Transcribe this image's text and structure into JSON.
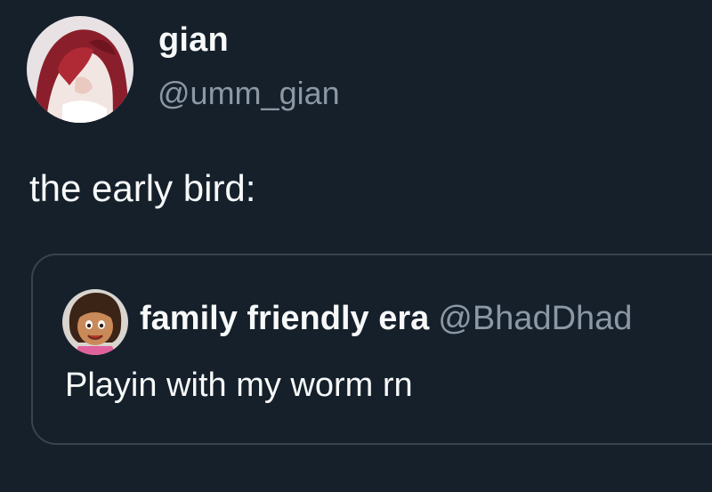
{
  "tweet": {
    "author": {
      "display_name": "gian",
      "handle": "@umm_gian",
      "avatar_icon": "anime-portrait-avatar-icon"
    },
    "text": "the early bird:",
    "quote": {
      "author": {
        "display_name": "family friendly era",
        "handle": "@BhadDhad",
        "avatar_icon": "cartoon-girl-avatar-icon"
      },
      "text": "Playin with my worm rn"
    }
  },
  "colors": {
    "background": "#15202b",
    "primary_text": "#f7f9f9",
    "secondary_text": "#8b98a5",
    "border": "#38444d"
  }
}
